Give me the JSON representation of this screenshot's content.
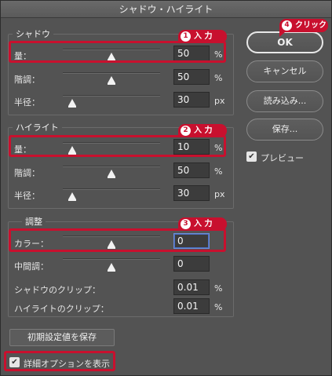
{
  "title": "シャドウ・ハイライト",
  "shadow": {
    "title": "シャドウ",
    "rows": [
      {
        "label": "量：",
        "value": "50",
        "unit": "%",
        "slider": 0.5
      },
      {
        "label": "階調：",
        "value": "50",
        "unit": "%",
        "slider": 0.5
      },
      {
        "label": "半径：",
        "value": "30",
        "unit": "px",
        "slider": 0.1
      }
    ]
  },
  "highlight": {
    "title": "ハイライト",
    "rows": [
      {
        "label": "量：",
        "value": "10",
        "unit": "%",
        "slider": 0.1
      },
      {
        "label": "階調：",
        "value": "50",
        "unit": "%",
        "slider": 0.5
      },
      {
        "label": "半径：",
        "value": "30",
        "unit": "px",
        "slider": 0.1
      }
    ]
  },
  "adjust": {
    "title": "調整",
    "rows": [
      {
        "label": "カラー：",
        "value": "0",
        "unit": "",
        "slider": 0.5
      },
      {
        "label": "中間調：",
        "value": "0",
        "unit": "",
        "slider": 0.5
      },
      {
        "label": "シャドウのクリップ：",
        "value": "0.01",
        "unit": "%"
      },
      {
        "label": "ハイライトのクリップ：",
        "value": "0.01",
        "unit": "%"
      }
    ]
  },
  "buttons": {
    "ok": "OK",
    "cancel": "キャンセル",
    "load": "読み込み...",
    "save": "保存...",
    "save_defaults": "初期設定値を保存"
  },
  "preview_label": "プレビュー",
  "preview_checked": true,
  "detail_label": "詳細オプションを表示",
  "detail_checked": true,
  "annotations": {
    "tag1": {
      "num": "1",
      "text": "入 力"
    },
    "tag2": {
      "num": "2",
      "text": "入 力"
    },
    "tag3": {
      "num": "3",
      "text": "入 力"
    },
    "tag4": {
      "num": "4",
      "text": "クリック"
    }
  },
  "colors": {
    "annotation": "#c8102e",
    "background": "#535353"
  }
}
